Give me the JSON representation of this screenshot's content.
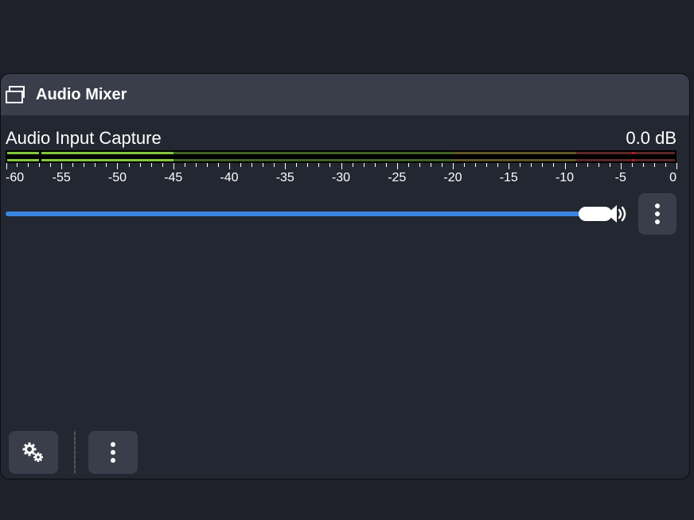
{
  "panel": {
    "title": "Audio Mixer"
  },
  "channel": {
    "name": "Audio Input Capture",
    "db_label": "0.0 dB",
    "meter": {
      "min": -60,
      "max": 0,
      "bright_fill_to": -45,
      "green_zone_to": -20,
      "yellow_zone_to": -9,
      "red_zone_to": 0,
      "peak_at": -4,
      "gap_at": -57
    },
    "scale_ticks": [
      -60,
      -55,
      -50,
      -45,
      -40,
      -35,
      -30,
      -25,
      -20,
      -15,
      -10,
      -5,
      0
    ],
    "slider": {
      "value_percent": 100
    }
  },
  "icons": {
    "dock": "dock",
    "speaker": "speaker",
    "kebab": "kebab",
    "gears": "gears"
  }
}
